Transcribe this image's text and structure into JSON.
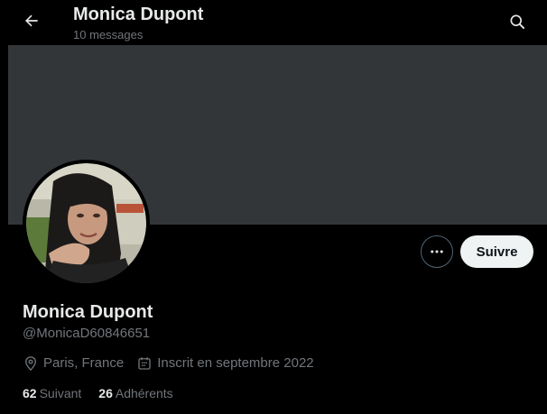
{
  "header": {
    "title": "Monica Dupont",
    "subtitle": "10 messages",
    "back_icon": "arrow-left-icon",
    "search_icon": "search-icon"
  },
  "banner": {
    "color": "#333639"
  },
  "actions": {
    "more_icon": "more-horizontal-icon",
    "follow_label": "Suivre"
  },
  "profile": {
    "display_name": "Monica Dupont",
    "handle": "@MonicaD60846651",
    "location": "Paris, France",
    "joined": "Inscrit en septembre 2022",
    "location_icon": "location-pin-icon",
    "calendar_icon": "calendar-icon"
  },
  "stats": {
    "following_count": "62",
    "following_label": "Suivant",
    "followers_count": "26",
    "followers_label": "Adhérents"
  },
  "colors": {
    "background": "#000000",
    "text_primary": "#e7e9ea",
    "text_secondary": "#71767b",
    "button_light": "#eff3f4",
    "border": "#536471"
  }
}
